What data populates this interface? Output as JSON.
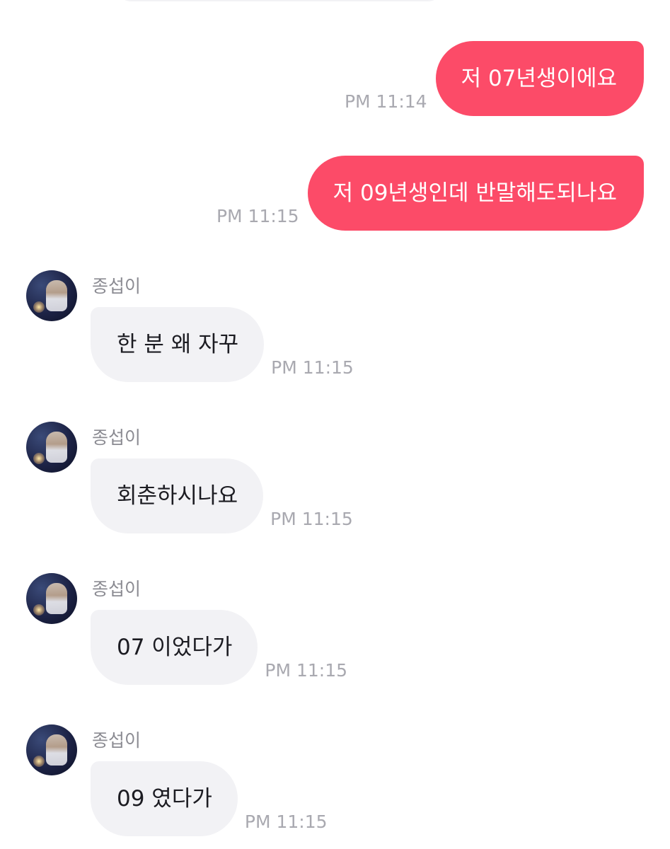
{
  "outgoing": [
    {
      "text": "저 07년생이에요",
      "time": "PM 11:14"
    },
    {
      "text": "저 09년생인데 반말해도되나요",
      "time": "PM 11:15"
    }
  ],
  "incoming": [
    {
      "sender": "종섭이",
      "text": "한 분 왜 자꾸",
      "time": "PM 11:15"
    },
    {
      "sender": "종섭이",
      "text": "회춘하시나요",
      "time": "PM 11:15"
    },
    {
      "sender": "종섭이",
      "text": "07 이었다가",
      "time": "PM 11:15"
    },
    {
      "sender": "종섭이",
      "text": "09 였다가",
      "time": "PM 11:15"
    }
  ],
  "colors": {
    "outgoing_bubble": "#fc4b68",
    "incoming_bubble": "#f2f2f5",
    "timestamp": "#a9a9b0",
    "sender_name": "#8b8b92"
  }
}
